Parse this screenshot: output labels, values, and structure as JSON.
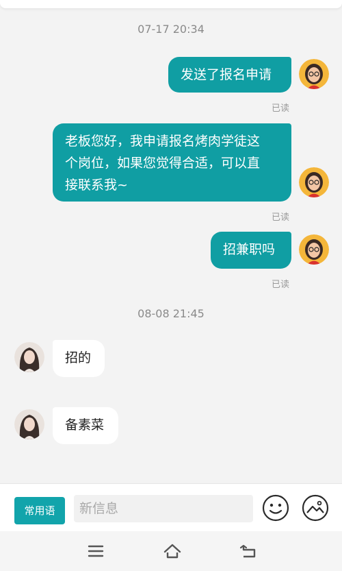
{
  "conversation": {
    "messages": [
      {
        "timestamp": "07-17 20:34"
      },
      {
        "text": "发送了报名申请",
        "status": "已读"
      },
      {
        "text_lines": [
          "老板您好，我申请报名烤肉学徒这",
          "个岗位，如果您觉得合适，可以直",
          "接联系我~"
        ],
        "status": "已读"
      },
      {
        "text": "招兼职吗",
        "status": "已读"
      },
      {
        "timestamp": "08-08 21:45"
      },
      {
        "text": "招的"
      },
      {
        "text": "备素菜"
      }
    ]
  },
  "composer": {
    "common_phrases_label": "常用语",
    "input_placeholder": "新信息",
    "emoji_icon": "smiley-face-icon",
    "image_icon": "image-icon"
  },
  "nav": {
    "menu_icon": "menu-icon",
    "home_icon": "home-icon",
    "back_icon": "back-icon"
  },
  "colors": {
    "outgoing_bubble": "#109ea3",
    "accent": "#12a4ab",
    "background": "#f3f3f3"
  }
}
